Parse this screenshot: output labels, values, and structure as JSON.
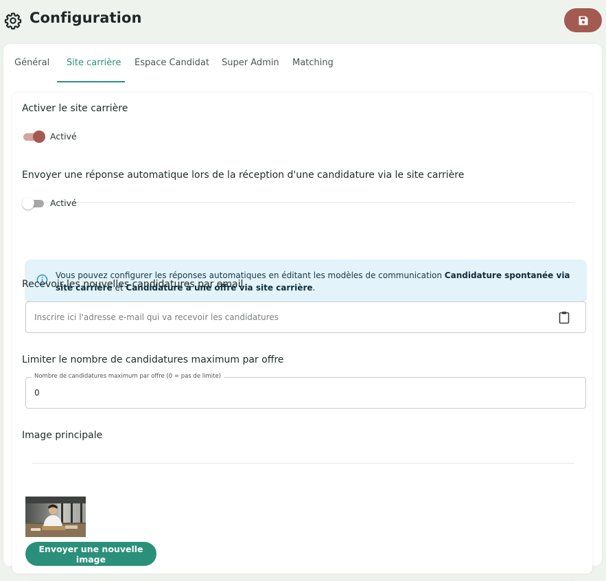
{
  "header": {
    "title": "Configuration",
    "icon": "gear-icon",
    "save_icon": "floppy-disk-icon",
    "accent_color": "#a35a50"
  },
  "tabs": [
    {
      "label": "Général",
      "active": false
    },
    {
      "label": "Site carrière",
      "active": true
    },
    {
      "label": "Espace Candidat",
      "active": false
    },
    {
      "label": "Super Admin",
      "active": false
    },
    {
      "label": "Matching",
      "active": false
    }
  ],
  "sections": {
    "activate_site": {
      "title": "Activer le site carrière",
      "toggle_on": true,
      "toggle_label": "Activé"
    },
    "auto_reply": {
      "title": "Envoyer une réponse automatique lors de la réception d'une candidature via le site carrière",
      "toggle_on": false,
      "toggle_label": "Activé",
      "info": {
        "icon": "info-icon",
        "text_part1": "Vous pouvez configurer les réponses automatiques en éditant les modèles de communication ",
        "bold1": "Candidature spontanée via site carrière",
        "text_part2": " et ",
        "bold2": "Candidature à une offre via site carrière",
        "text_part3": "."
      }
    },
    "email": {
      "title": "Recevoir les nouvelles candidatures par email",
      "placeholder": "Inscrire ici l'adresse e-mail qui va recevoir les candidatures",
      "value": "",
      "icon": "clipboard-icon"
    },
    "limit": {
      "title": "Limiter le nombre de candidatures maximum par offre",
      "field_label": "Nombre de candidatures maximum par offre (0 = pas de limite)",
      "value": "0"
    },
    "image": {
      "title": "Image principale",
      "button_label": "Envoyer une nouvelle image"
    }
  },
  "colors": {
    "primary_green": "#2a9079",
    "info_bg": "#e2f3fa",
    "page_bg": "#eff3ee"
  }
}
